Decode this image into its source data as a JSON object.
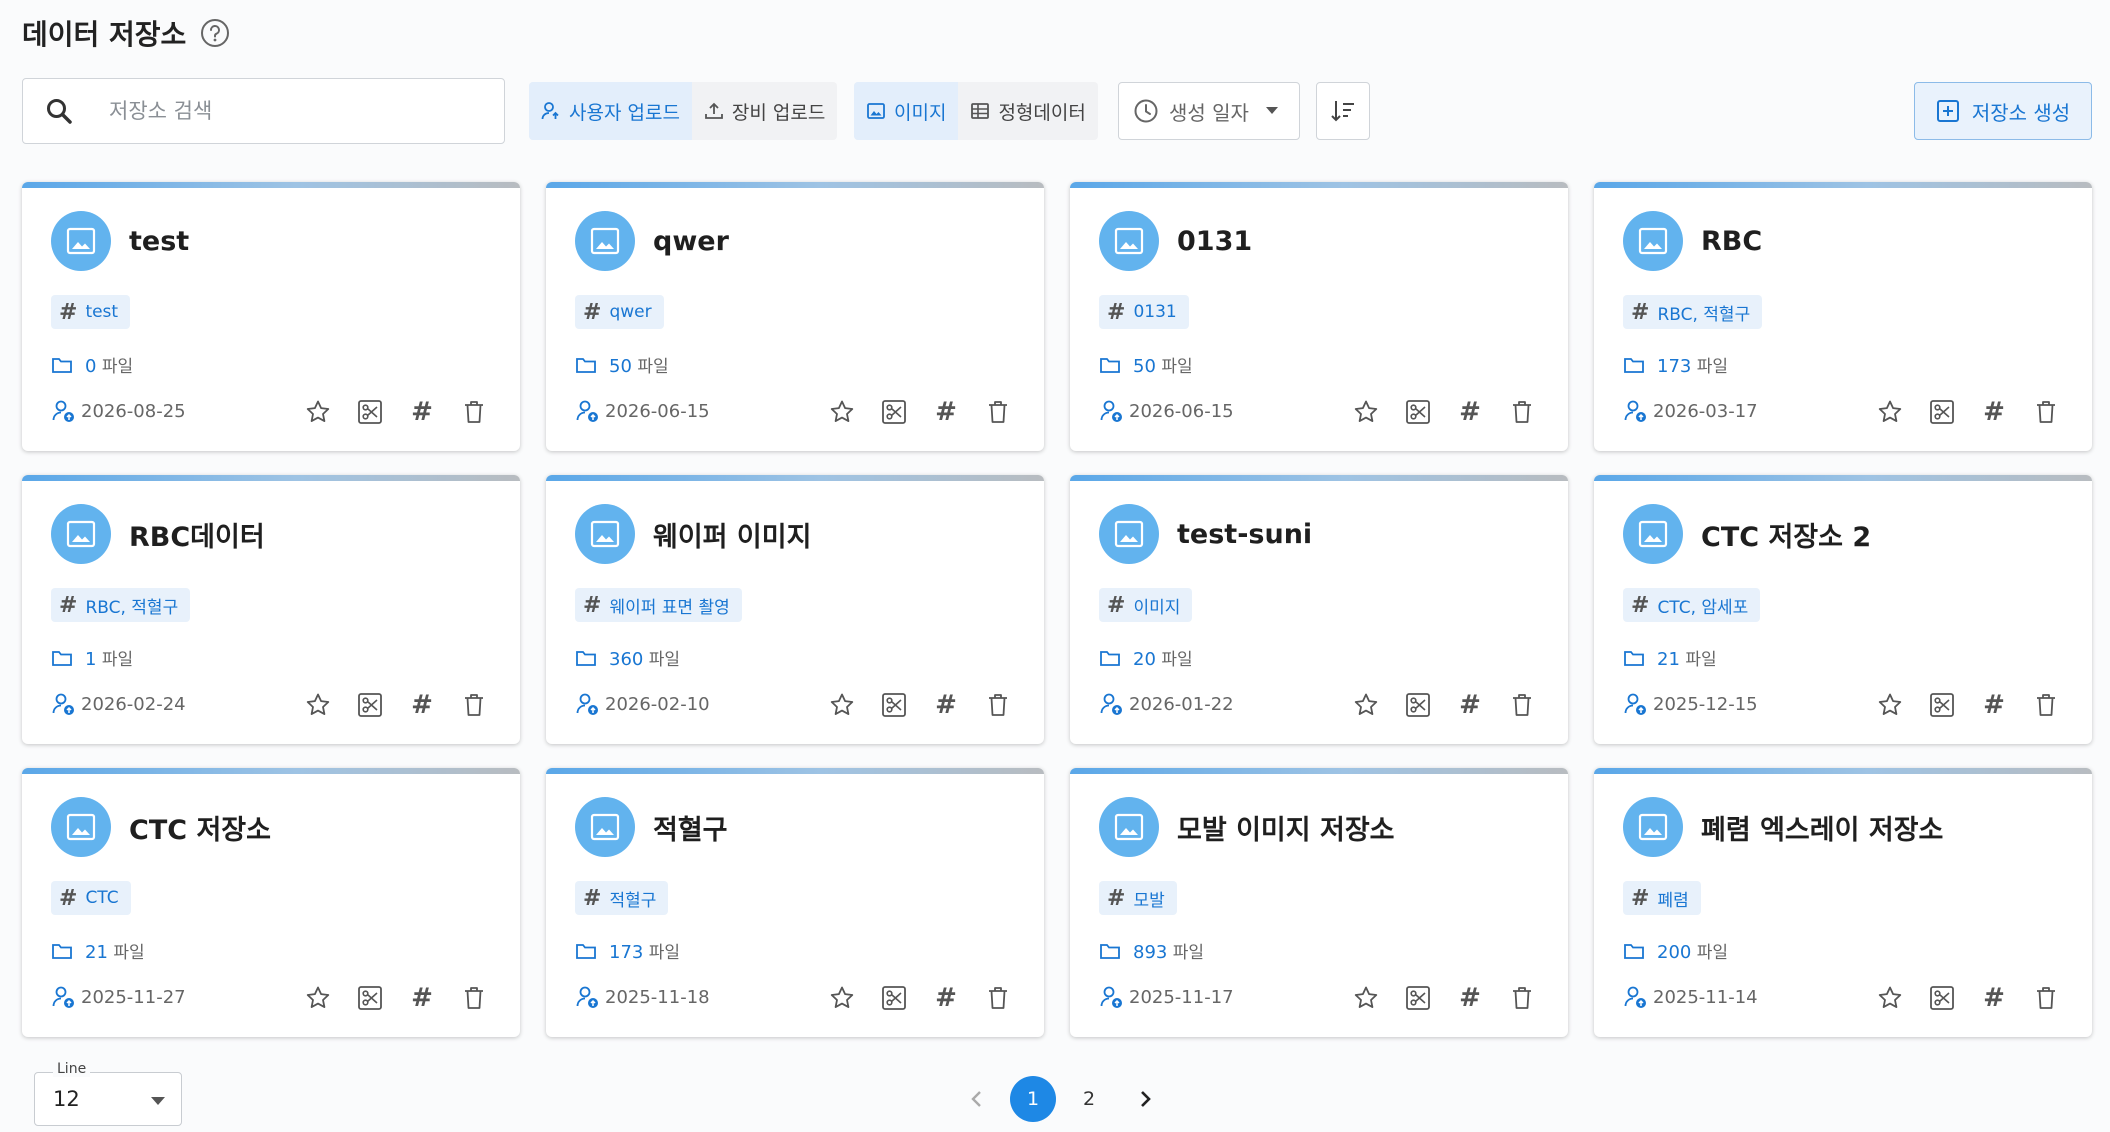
{
  "header": {
    "title": "데이터 저장소"
  },
  "toolbar": {
    "search_placeholder": "저장소 검색",
    "source_filters": [
      {
        "label": "사용자 업로드",
        "active": true
      },
      {
        "label": "장비 업로드",
        "active": false
      }
    ],
    "type_filters": [
      {
        "label": "이미지",
        "active": true
      },
      {
        "label": "정형데이터",
        "active": false
      }
    ],
    "sort_label": "생성 일자",
    "create_label": "저장소 생성"
  },
  "repositories": [
    {
      "name": "test",
      "tag": "test",
      "files": "0",
      "files_unit": "파일",
      "date": "2026-08-25"
    },
    {
      "name": "qwer",
      "tag": "qwer",
      "files": "50",
      "files_unit": "파일",
      "date": "2026-06-15"
    },
    {
      "name": "0131",
      "tag": "0131",
      "files": "50",
      "files_unit": "파일",
      "date": "2026-06-15"
    },
    {
      "name": "RBC",
      "tag": "RBC, 적혈구",
      "files": "173",
      "files_unit": "파일",
      "date": "2026-03-17"
    },
    {
      "name": "RBC데이터",
      "tag": "RBC, 적혈구",
      "files": "1",
      "files_unit": "파일",
      "date": "2026-02-24"
    },
    {
      "name": "웨이퍼 이미지",
      "tag": "웨이퍼 표면 촬영",
      "files": "360",
      "files_unit": "파일",
      "date": "2026-02-10"
    },
    {
      "name": "test-suni",
      "tag": "이미지",
      "files": "20",
      "files_unit": "파일",
      "date": "2026-01-22"
    },
    {
      "name": "CTC 저장소 2",
      "tag": "CTC, 암세포",
      "files": "21",
      "files_unit": "파일",
      "date": "2025-12-15"
    },
    {
      "name": "CTC 저장소",
      "tag": "CTC",
      "files": "21",
      "files_unit": "파일",
      "date": "2025-11-27"
    },
    {
      "name": "적혈구",
      "tag": "적혈구",
      "files": "173",
      "files_unit": "파일",
      "date": "2025-11-18"
    },
    {
      "name": "모발 이미지 저장소",
      "tag": "모발",
      "files": "893",
      "files_unit": "파일",
      "date": "2025-11-17"
    },
    {
      "name": "폐렴 엑스레이 저장소",
      "tag": "폐렴",
      "files": "200",
      "files_unit": "파일",
      "date": "2025-11-14"
    }
  ],
  "pagination": {
    "line_label": "Line",
    "line_value": "12",
    "pages": [
      "1",
      "2"
    ],
    "current": "1"
  },
  "colors": {
    "accent": "#1976d2",
    "icon_bg": "#62b3ee",
    "page_active": "#1e88e5"
  }
}
